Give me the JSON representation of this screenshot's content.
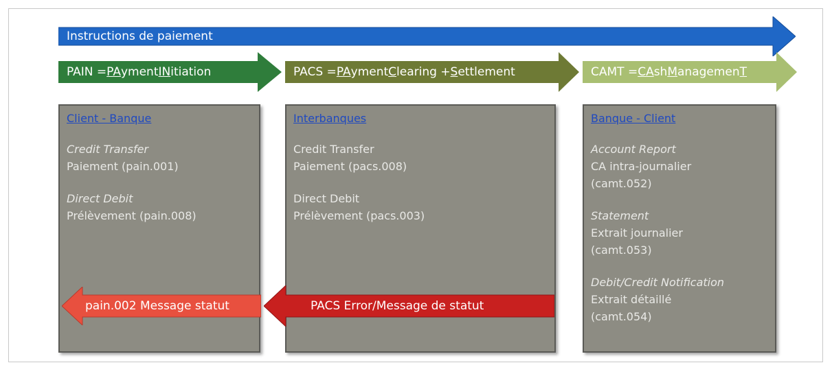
{
  "top_arrow": {
    "label": "Instructions de paiement",
    "color": "#1f67c6"
  },
  "categories": [
    {
      "parts": [
        "PAIN = ",
        "PA",
        "yment ",
        "IN",
        "itiation"
      ],
      "color": "#2f7d3b"
    },
    {
      "parts": [
        "PACS = ",
        "PA",
        "yment ",
        "C",
        "learing + ",
        "S",
        "ettlement"
      ],
      "color": "#6e7a35"
    },
    {
      "parts": [
        "CAMT = ",
        "CA",
        "sh ",
        "M",
        "anagemen",
        "T"
      ],
      "color": "#a9bf72"
    }
  ],
  "boxes": [
    {
      "title": "Client - Banque",
      "messages": [
        {
          "type": "Credit Transfer",
          "lines": [
            "Paiement (pain.001)"
          ],
          "italic": true
        },
        {
          "type": "Direct Debit",
          "lines": [
            "Prélèvement (pain.008)"
          ],
          "italic": true
        }
      ]
    },
    {
      "title": "Interbanques",
      "messages": [
        {
          "type": "Credit Transfer",
          "lines": [
            "Paiement (pacs.008)"
          ],
          "italic": false
        },
        {
          "type": "Direct Debit",
          "lines": [
            "Prélèvement (pacs.003)"
          ],
          "italic": false
        }
      ]
    },
    {
      "title": "Banque - Client",
      "messages": [
        {
          "type": "Account Report",
          "lines": [
            "CA intra-journalier",
            "(camt.052)"
          ],
          "italic": true
        },
        {
          "type": "Statement",
          "lines": [
            "Extrait journalier",
            "(camt.053)"
          ],
          "italic": true
        },
        {
          "type": "Debit/Credit Notification",
          "lines": [
            "Extrait détaillé",
            "(camt.054)"
          ],
          "italic": true
        }
      ]
    }
  ],
  "status_arrows": [
    {
      "label": "pain.002 Message statut",
      "color": "#e8503f"
    },
    {
      "label": "PACS Error/Message de statut",
      "color": "#c8201f"
    }
  ]
}
